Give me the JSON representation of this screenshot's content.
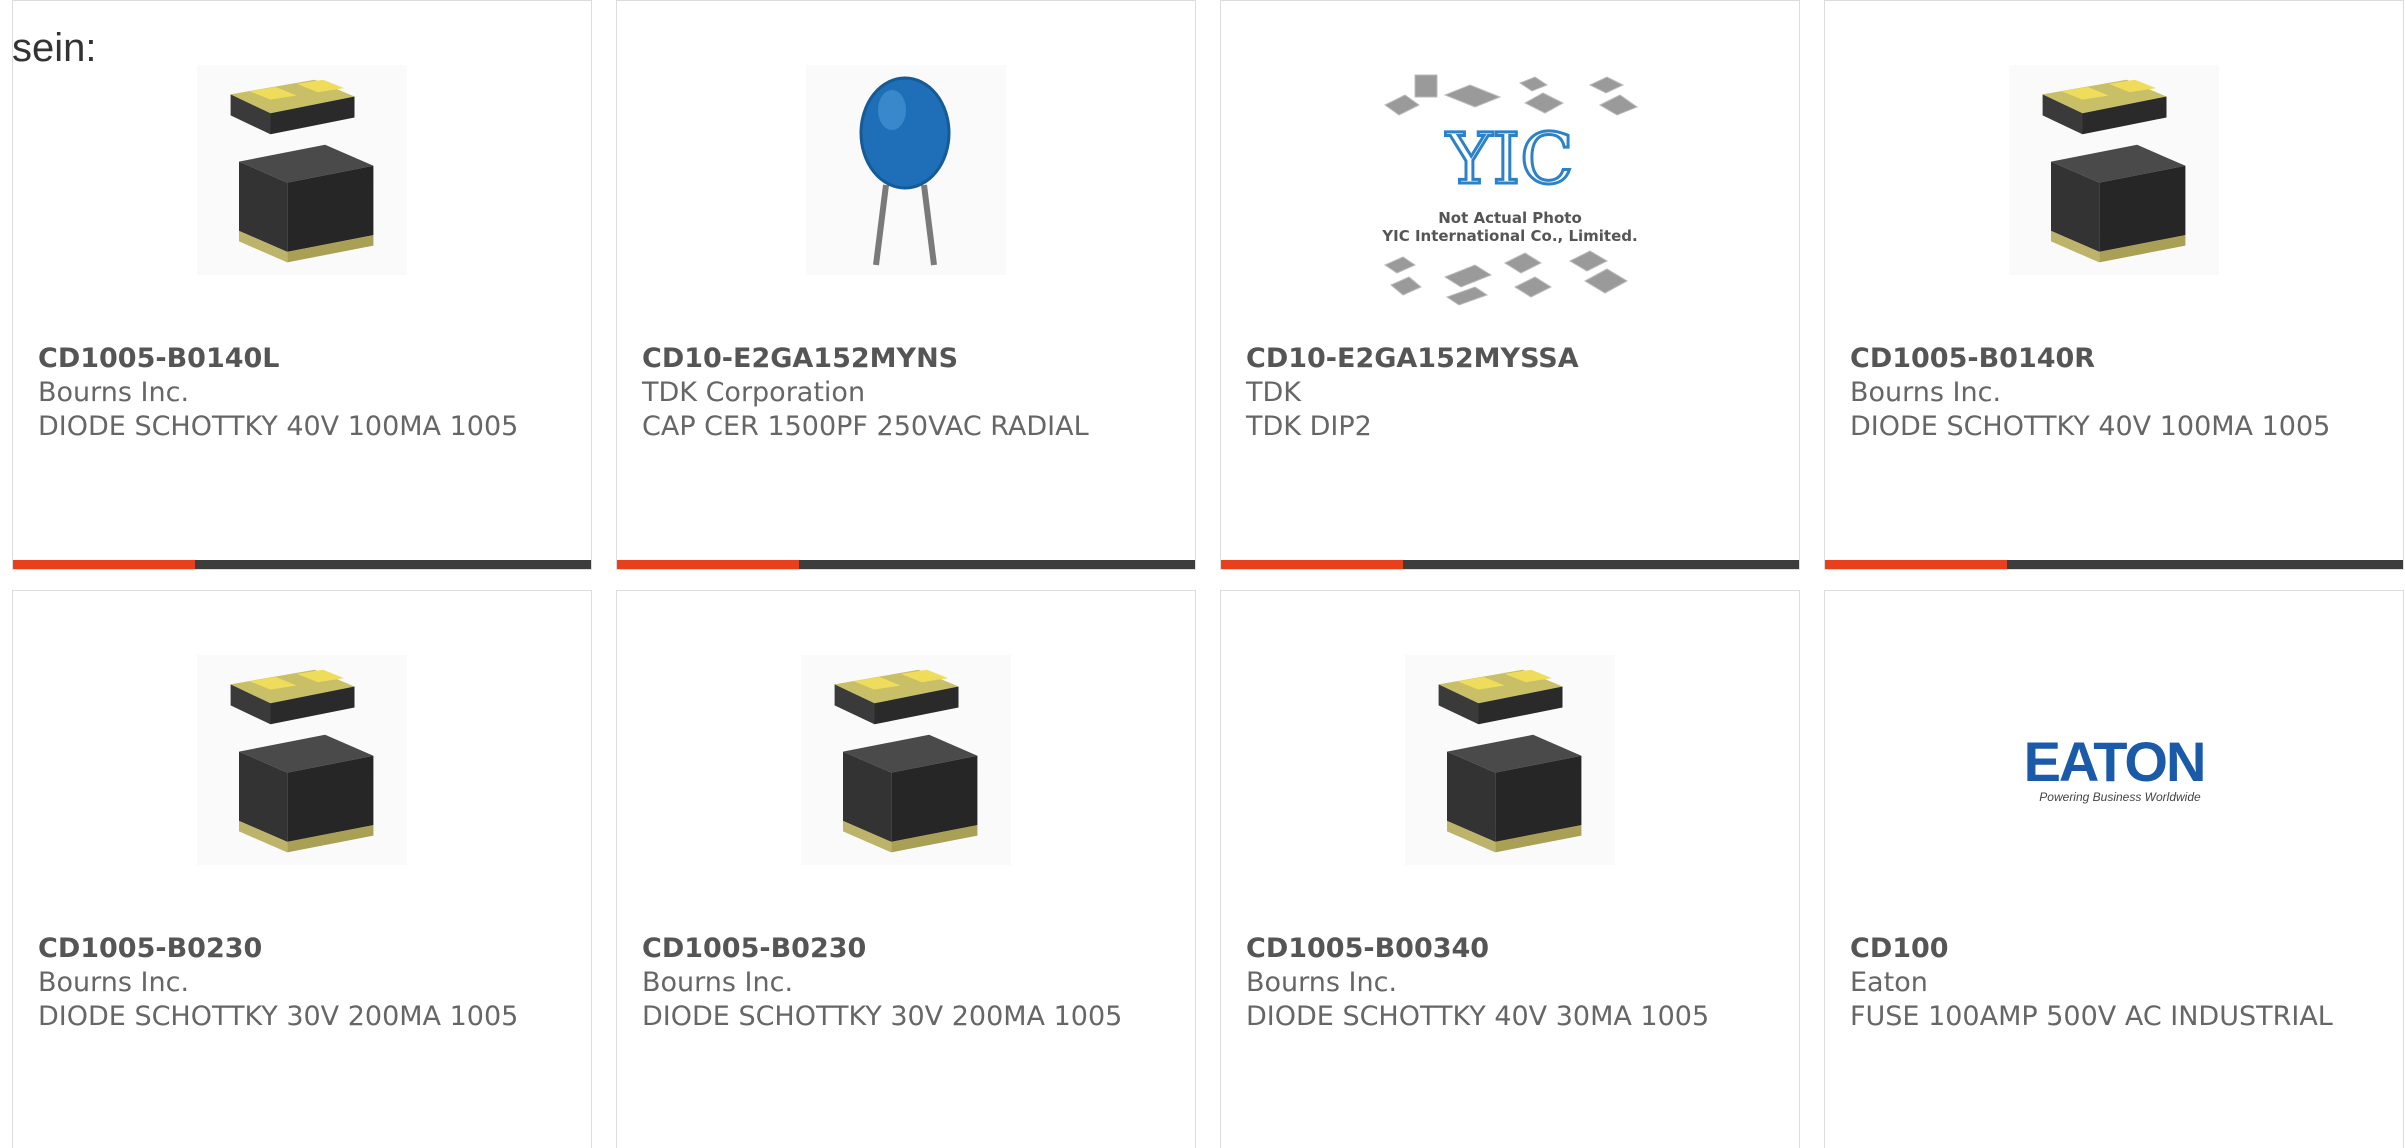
{
  "heading": "sein:",
  "colors": {
    "accent": "#e8401c",
    "bar": "#3d3d3d",
    "border": "#dcdcdc",
    "text": "#666666"
  },
  "products": [
    {
      "part": "CD1005-B0140L",
      "manufacturer": "Bourns Inc.",
      "description": "DIODE SCHOTTKY 40V 100MA 1005",
      "image": "smd-diode-package-image"
    },
    {
      "part": "CD10-E2GA152MYNS",
      "manufacturer": "TDK Corporation",
      "description": "CAP CER 1500PF 250VAC RADIAL",
      "image": "ceramic-disc-capacitor-image"
    },
    {
      "part": "CD10-E2GA152MYSSA",
      "manufacturer": "TDK",
      "description": "TDK DIP2",
      "image": "yic-placeholder-image",
      "image_caption_line1": "Not Actual Photo",
      "image_caption_line2": "YIC International Co., Limited.",
      "image_logo": "YIC"
    },
    {
      "part": "CD1005-B0140R",
      "manufacturer": "Bourns Inc.",
      "description": "DIODE SCHOTTKY 40V 100MA 1005",
      "image": "smd-diode-package-image"
    },
    {
      "part": "CD1005-B0230",
      "manufacturer": "Bourns Inc.",
      "description": "DIODE SCHOTTKY 30V 200MA 1005",
      "image": "smd-diode-package-image"
    },
    {
      "part": "CD1005-B0230",
      "manufacturer": "Bourns Inc.",
      "description": "DIODE SCHOTTKY 30V 200MA 1005",
      "image": "smd-diode-package-image"
    },
    {
      "part": "CD1005-B00340",
      "manufacturer": "Bourns Inc.",
      "description": "DIODE SCHOTTKY 40V 30MA 1005",
      "image": "smd-diode-package-image"
    },
    {
      "part": "CD100",
      "manufacturer": "Eaton",
      "description": "FUSE 100AMP 500V AC INDUSTRIAL",
      "image": "eaton-logo-image",
      "image_logo": "EATON",
      "image_tagline": "Powering Business Worldwide"
    }
  ]
}
